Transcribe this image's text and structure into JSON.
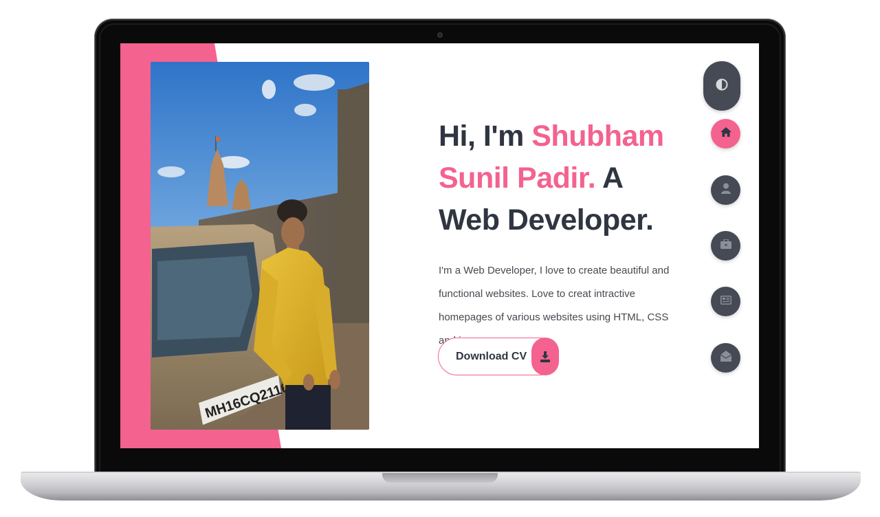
{
  "hero": {
    "greeting": "Hi, I'm ",
    "name": "Shubham Sunil Padir.",
    "role_suffix": " A Web Developer.",
    "bio": "I'm a Web Developer, I love to create beautiful and functional websites. Love to creat intractive homepages of various websites using HTML, CSS and js"
  },
  "cta": {
    "download_label": "Download CV",
    "download_icon": "download-icon"
  },
  "nav": {
    "theme_icon": "contrast-icon",
    "items": [
      {
        "name": "home",
        "icon": "home-icon",
        "active": true
      },
      {
        "name": "about",
        "icon": "user-icon",
        "active": false
      },
      {
        "name": "portfolio",
        "icon": "briefcase-icon",
        "active": false
      },
      {
        "name": "blogs",
        "icon": "newspaper-icon",
        "active": false
      },
      {
        "name": "contact",
        "icon": "envelope-open-icon",
        "active": false
      }
    ]
  },
  "photo": {
    "plate_text": "MH16CQ2116"
  },
  "colors": {
    "accent": "#f4628f",
    "dark": "#2f3541",
    "nav_bg": "#454a55"
  }
}
